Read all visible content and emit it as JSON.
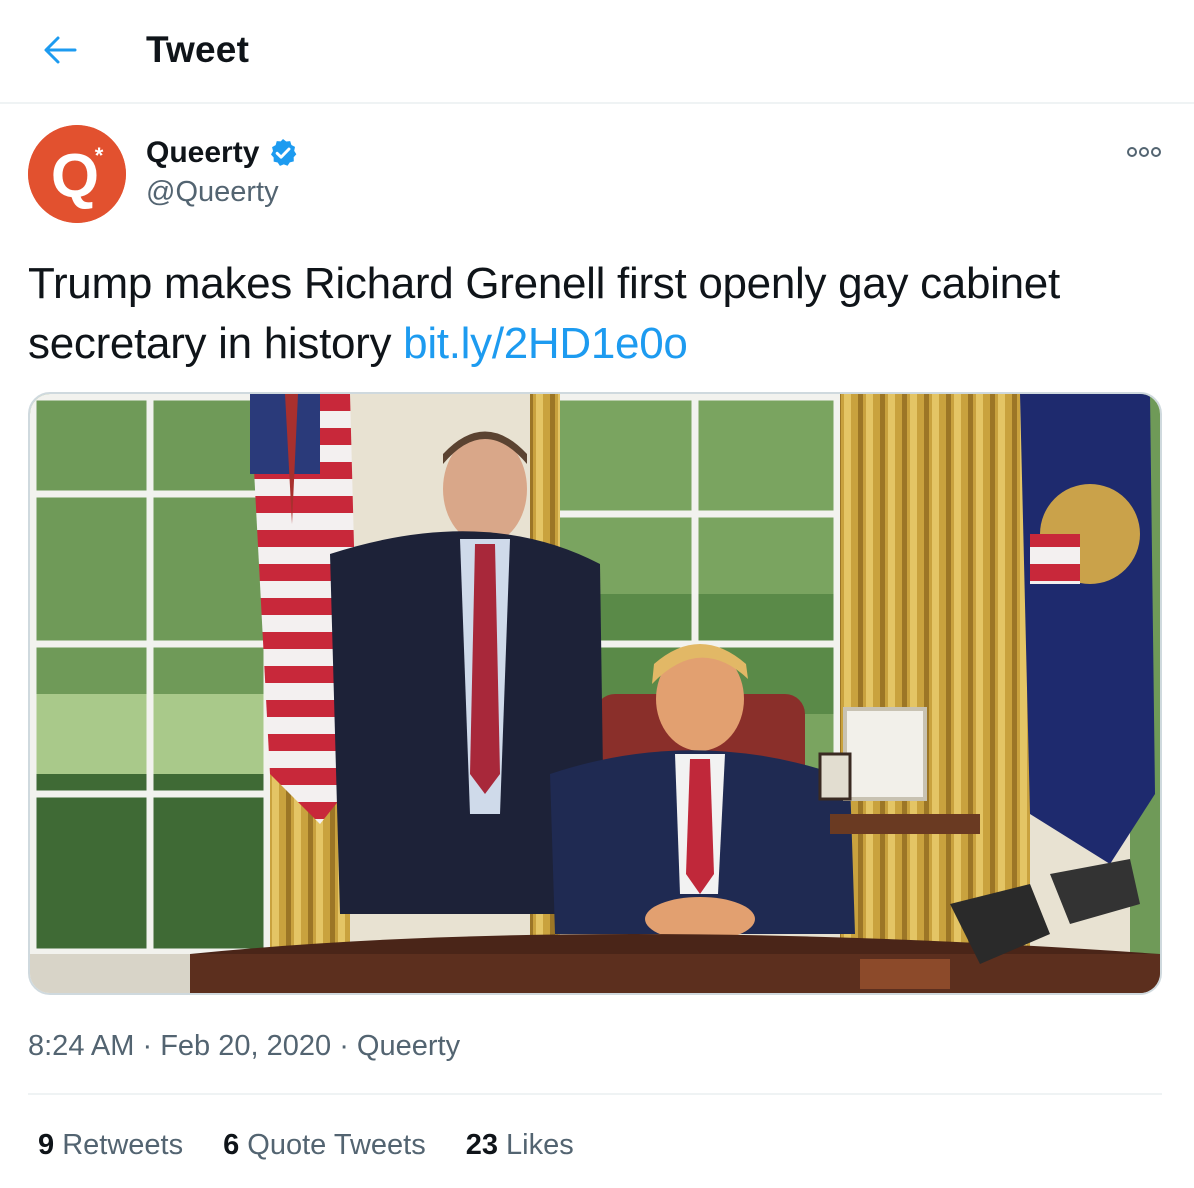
{
  "header": {
    "title": "Tweet",
    "back_icon": "back-arrow-icon"
  },
  "tweet": {
    "author_name": "Queerty",
    "author_handle": "@Queerty",
    "verified_icon": "verified-badge-icon",
    "avatar_letter": "Q",
    "text": "Trump makes Richard Grenell first openly gay cabinet secretary in history ",
    "link": "bit.ly/2HD1e0o",
    "time": "8:24 AM",
    "date": "Feb 20, 2020",
    "source": "Queerty",
    "separator": "·"
  },
  "stats": {
    "retweets_count": "9",
    "retweets_label": "Retweets",
    "quote_count": "6",
    "quote_label": "Quote Tweets",
    "likes_count": "23",
    "likes_label": "Likes"
  },
  "colors": {
    "accent": "#1d9bf0",
    "avatar_bg": "#e2512f",
    "muted": "#536471"
  }
}
